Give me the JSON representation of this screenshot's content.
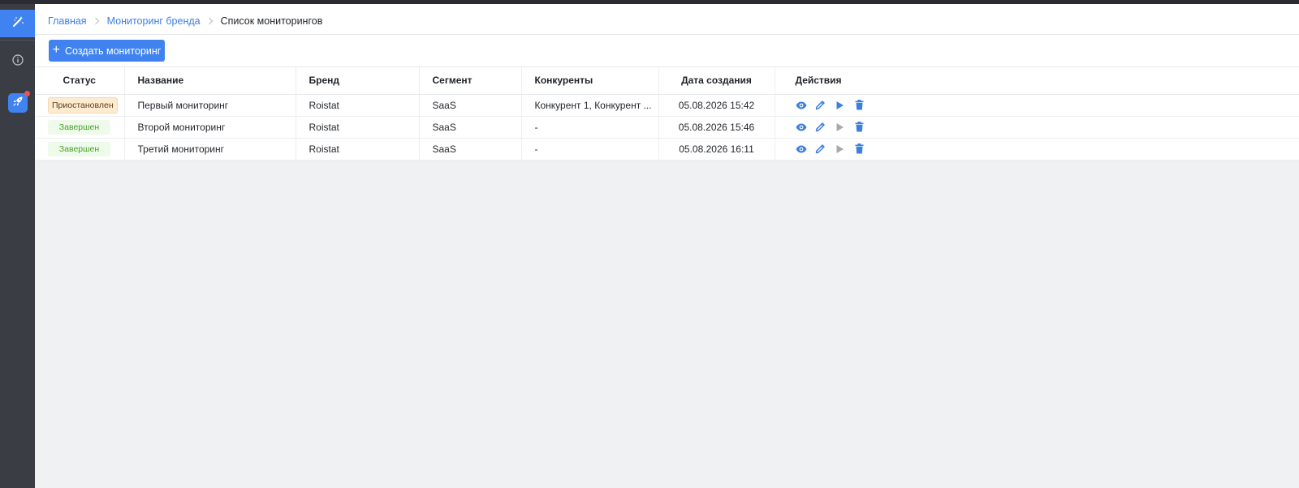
{
  "breadcrumb": {
    "home": "Главная",
    "section": "Мониторинг бренда",
    "current": "Список мониторингов"
  },
  "toolbar": {
    "create_label": "Создать мониторинг"
  },
  "table": {
    "headers": {
      "status": "Статус",
      "name": "Название",
      "brand": "Бренд",
      "segment": "Сегмент",
      "competitors": "Конкуренты",
      "created": "Дата создания",
      "actions": "Действия"
    },
    "rows": [
      {
        "status": "Приостановлен",
        "status_type": "paused",
        "name": "Первый мониторинг",
        "brand": "Roistat",
        "segment": "SaaS",
        "competitors": "Конкурент 1, Конкурент ...",
        "created": "05.08.2026 15:42",
        "play_enabled": true
      },
      {
        "status": "Завершен",
        "status_type": "done",
        "name": "Второй мониторинг",
        "brand": "Roistat",
        "segment": "SaaS",
        "competitors": "-",
        "created": "05.08.2026 15:46",
        "play_enabled": false
      },
      {
        "status": "Завершен",
        "status_type": "done",
        "name": "Третий мониторинг",
        "brand": "Roistat",
        "segment": "SaaS",
        "competitors": "-",
        "created": "05.08.2026 16:11",
        "play_enabled": false
      }
    ]
  },
  "icons": {
    "sidebar": [
      "magic-wand-icon",
      "info-icon",
      "rocket-icon"
    ],
    "actions": [
      "eye-icon",
      "pencil-icon",
      "play-icon",
      "trash-icon"
    ]
  },
  "colors": {
    "accent": "#4083f0",
    "sidebar_bg": "#3a3d44",
    "paused_bg": "#fdebd0",
    "done_bg": "#eefaea",
    "done_text": "#45a229",
    "disabled_icon": "#a6a9ae",
    "notification_dot": "#ef5350"
  }
}
